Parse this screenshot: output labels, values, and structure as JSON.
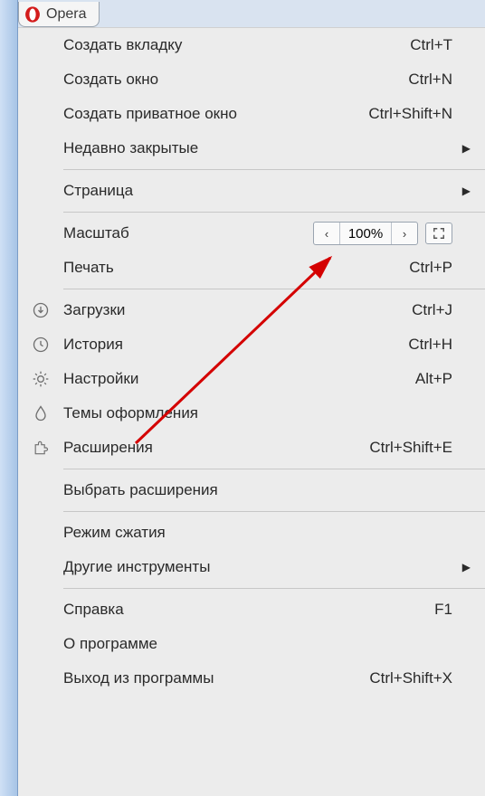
{
  "tab": {
    "label": "Opera"
  },
  "menu": {
    "new_tab": {
      "label": "Создать вкладку",
      "shortcut": "Ctrl+T"
    },
    "new_window": {
      "label": "Создать окно",
      "shortcut": "Ctrl+N"
    },
    "new_private": {
      "label": "Создать приватное окно",
      "shortcut": "Ctrl+Shift+N"
    },
    "recent": {
      "label": "Недавно закрытые"
    },
    "page": {
      "label": "Страница"
    },
    "zoom": {
      "label": "Масштаб",
      "value": "100%"
    },
    "print": {
      "label": "Печать",
      "shortcut": "Ctrl+P"
    },
    "downloads": {
      "label": "Загрузки",
      "shortcut": "Ctrl+J"
    },
    "history": {
      "label": "История",
      "shortcut": "Ctrl+H"
    },
    "settings": {
      "label": "Настройки",
      "shortcut": "Alt+P"
    },
    "themes": {
      "label": "Темы оформления"
    },
    "extensions": {
      "label": "Расширения",
      "shortcut": "Ctrl+Shift+E"
    },
    "get_extensions": {
      "label": "Выбрать расширения"
    },
    "compression": {
      "label": "Режим сжатия"
    },
    "more_tools": {
      "label": "Другие инструменты"
    },
    "help": {
      "label": "Справка",
      "shortcut": "F1"
    },
    "about": {
      "label": "О программе"
    },
    "exit": {
      "label": "Выход из программы",
      "shortcut": "Ctrl+Shift+X"
    }
  }
}
